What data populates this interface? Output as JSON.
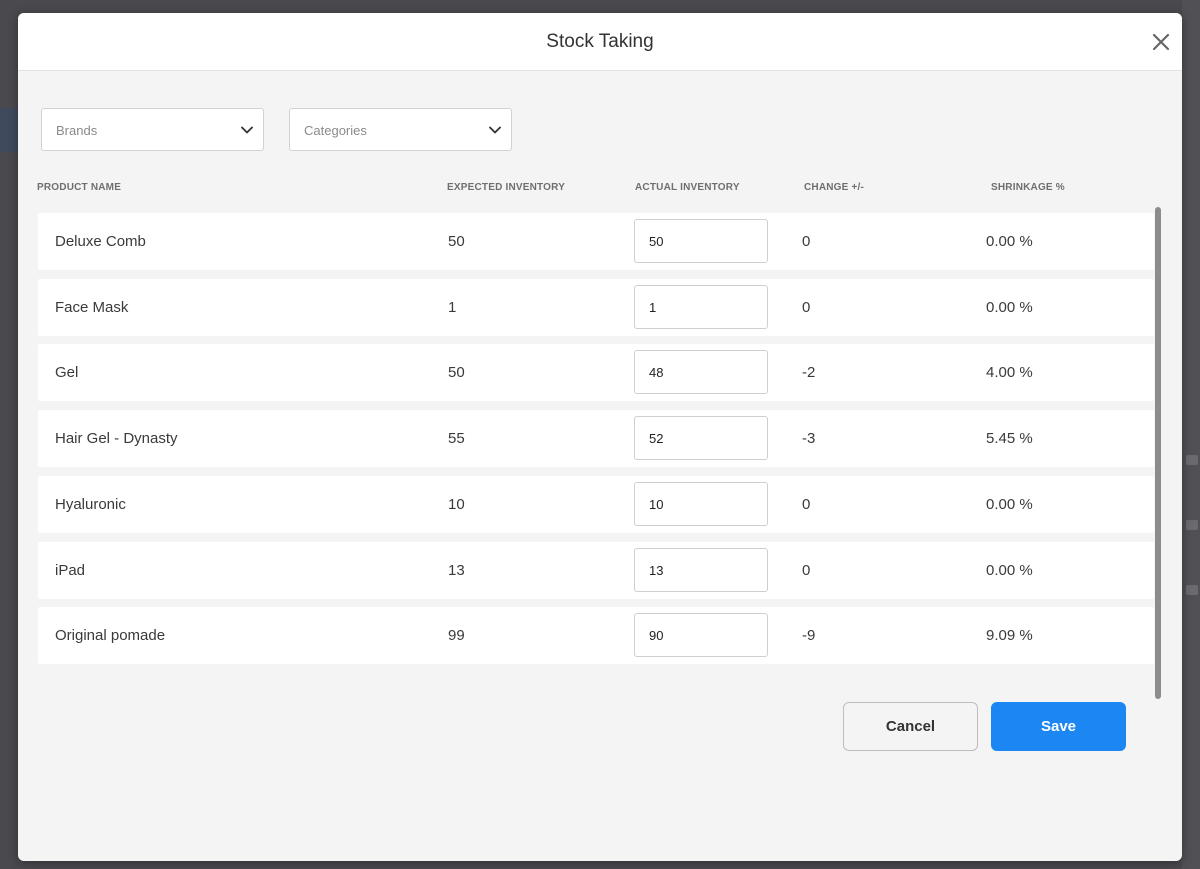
{
  "dialog": {
    "title": "Stock Taking",
    "close_icon": "close-icon"
  },
  "filters": {
    "brands_placeholder": "Brands",
    "categories_placeholder": "Categories"
  },
  "table": {
    "headers": {
      "product_name": "PRODUCT NAME",
      "expected": "EXPECTED INVENTORY",
      "actual": "ACTUAL INVENTORY",
      "change": "CHANGE +/-",
      "shrinkage": "SHRINKAGE %"
    },
    "rows": [
      {
        "name": "Deluxe Comb",
        "expected": "50",
        "actual": "50",
        "change": "0",
        "shrinkage": "0.00 %"
      },
      {
        "name": "Face Mask",
        "expected": "1",
        "actual": "1",
        "change": "0",
        "shrinkage": "0.00 %"
      },
      {
        "name": "Gel",
        "expected": "50",
        "actual": "48",
        "change": "-2",
        "shrinkage": "4.00 %"
      },
      {
        "name": "Hair Gel - Dynasty",
        "expected": "55",
        "actual": "52",
        "change": "-3",
        "shrinkage": "5.45 %"
      },
      {
        "name": "Hyaluronic",
        "expected": "10",
        "actual": "10",
        "change": "0",
        "shrinkage": "0.00 %"
      },
      {
        "name": "iPad",
        "expected": "13",
        "actual": "13",
        "change": "0",
        "shrinkage": "0.00 %"
      },
      {
        "name": "Original pomade",
        "expected": "99",
        "actual": "90",
        "change": "-9",
        "shrinkage": "9.09 %"
      }
    ]
  },
  "actions": {
    "cancel_label": "Cancel",
    "save_label": "Save"
  },
  "colors": {
    "primary": "#1c86f2",
    "modal_bg": "#f4f4f4",
    "overlay": "#4a4a4e"
  }
}
